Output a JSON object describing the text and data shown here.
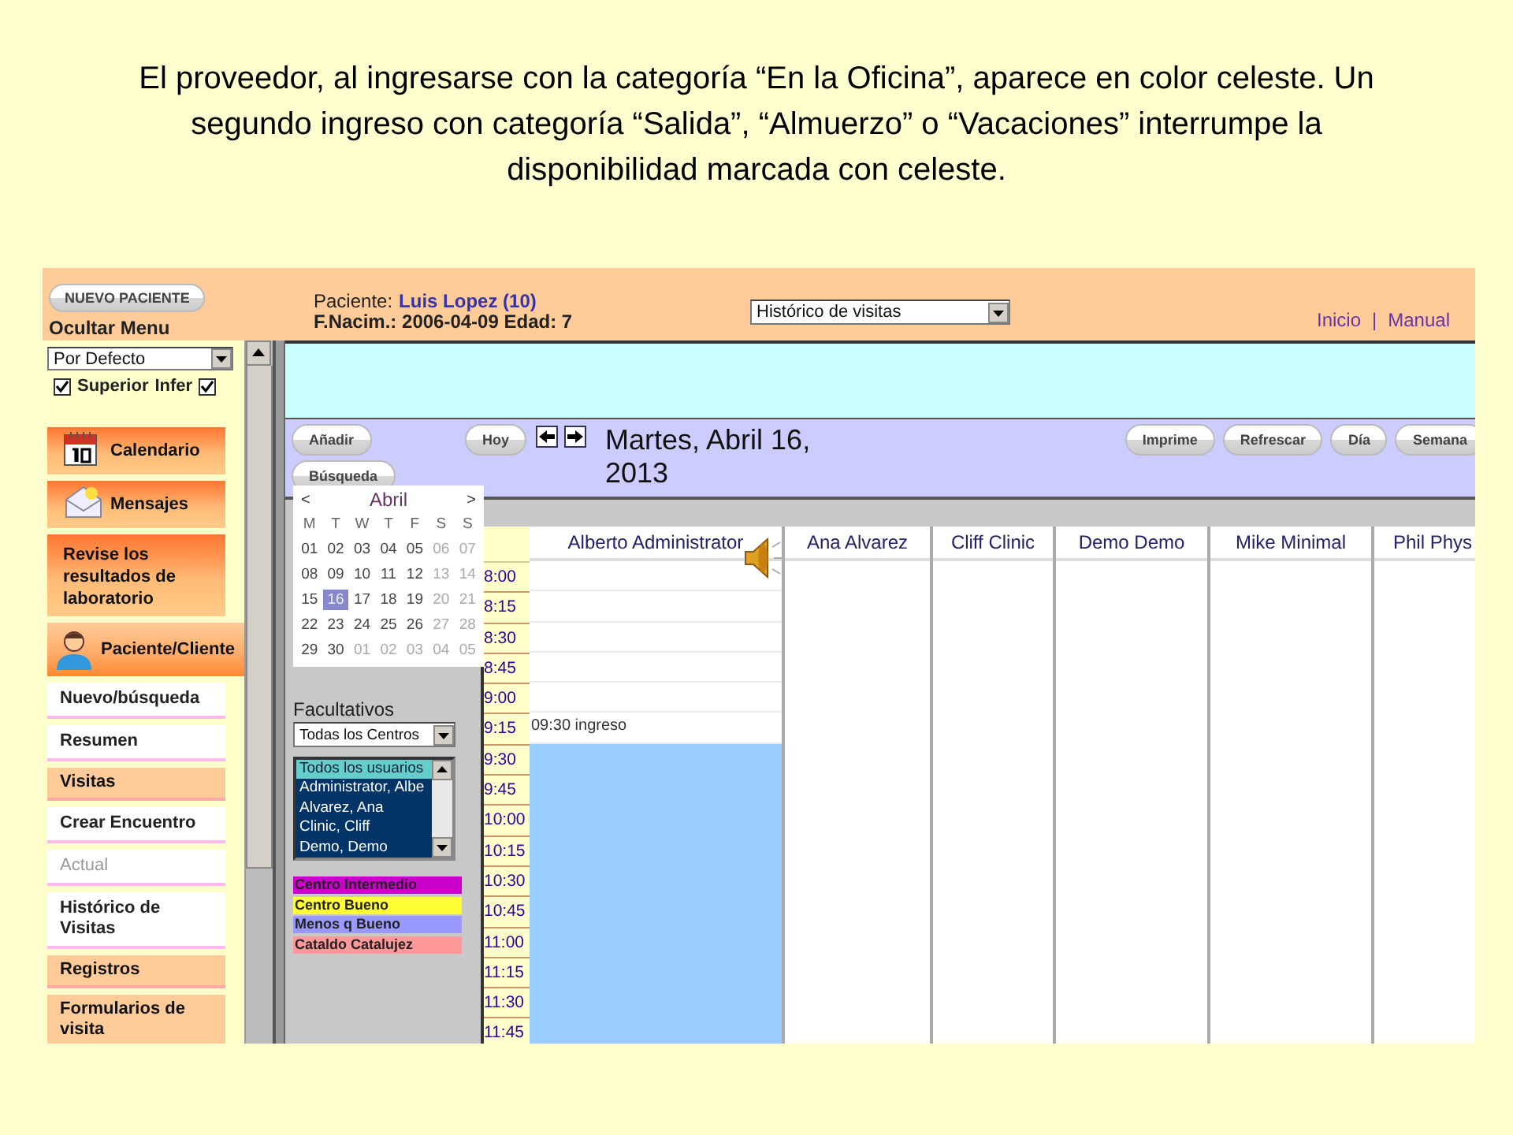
{
  "slide": {
    "caption": "El proveedor, al ingresarse con la categoría “En la Oficina”, aparece en color celeste. Un segundo ingreso con categoría “Salida”, “Almuerzo” o “Vacaciones” interrumpe la disponibilidad marcada con celeste."
  },
  "header": {
    "new_patient_button": "NUEVO PACIENTE",
    "hide_menu": "Ocultar Menu",
    "patient_label": "Paciente:",
    "patient_name": "Luis Lopez (10)",
    "birth_info": "F.Nacim.: 2006-04-09 Edad: 7",
    "view_select": "Histórico de visitas",
    "links": [
      "Inicio",
      "Manual"
    ],
    "separator": "|"
  },
  "sidebar": {
    "profile_select": "Por Defecto",
    "checkboxes": [
      {
        "label": "Superior",
        "checked": true
      },
      {
        "label": "Infer",
        "checked": true
      }
    ],
    "items": [
      {
        "kind": "calendar",
        "label": "Calendario",
        "disabled": false
      },
      {
        "kind": "messages",
        "label": "Mensajes",
        "disabled": false
      },
      {
        "kind": "plain",
        "label": "Revise los resultados de laboratorio",
        "disabled": false
      },
      {
        "kind": "patient",
        "label": "Paciente/Cliente",
        "disabled": false
      },
      {
        "kind": "link",
        "label": "Nuevo/búsqueda",
        "disabled": false
      },
      {
        "kind": "link",
        "label": "Resumen",
        "disabled": false
      },
      {
        "kind": "section",
        "label": "Visitas",
        "disabled": false
      },
      {
        "kind": "link",
        "label": "Crear Encuentro",
        "disabled": false
      },
      {
        "kind": "link",
        "label": "Actual",
        "disabled": true
      },
      {
        "kind": "link",
        "label": "Histórico de Visitas",
        "disabled": false
      },
      {
        "kind": "section",
        "label": "Registros",
        "disabled": false
      },
      {
        "kind": "section",
        "label": "Formularios de visita",
        "disabled": false
      }
    ]
  },
  "toolbar": {
    "left_buttons": [
      "Añadir",
      "Búsqueda",
      "Hoy"
    ],
    "date_title": "Martes, Abril 16, 2013",
    "right_buttons": [
      "Imprime",
      "Refrescar",
      "Día",
      "Semana"
    ]
  },
  "mini_calendar": {
    "prev": "<",
    "month": "Abril",
    "next": ">",
    "weekdays": [
      "M",
      "T",
      "W",
      "T",
      "F",
      "S",
      "S"
    ],
    "weeks": [
      [
        {
          "day": "01",
          "muted": false,
          "selected": false
        },
        {
          "day": "02",
          "muted": false,
          "selected": false
        },
        {
          "day": "03",
          "muted": false,
          "selected": false
        },
        {
          "day": "04",
          "muted": false,
          "selected": false
        },
        {
          "day": "05",
          "muted": false,
          "selected": false
        },
        {
          "day": "06",
          "muted": true,
          "selected": false
        },
        {
          "day": "07",
          "muted": true,
          "selected": false
        }
      ],
      [
        {
          "day": "08",
          "muted": false,
          "selected": false
        },
        {
          "day": "09",
          "muted": false,
          "selected": false
        },
        {
          "day": "10",
          "muted": false,
          "selected": false
        },
        {
          "day": "11",
          "muted": false,
          "selected": false
        },
        {
          "day": "12",
          "muted": false,
          "selected": false
        },
        {
          "day": "13",
          "muted": true,
          "selected": false
        },
        {
          "day": "14",
          "muted": true,
          "selected": false
        }
      ],
      [
        {
          "day": "15",
          "muted": false,
          "selected": false
        },
        {
          "day": "16",
          "muted": false,
          "selected": true
        },
        {
          "day": "17",
          "muted": false,
          "selected": false
        },
        {
          "day": "18",
          "muted": false,
          "selected": false
        },
        {
          "day": "19",
          "muted": false,
          "selected": false
        },
        {
          "day": "20",
          "muted": true,
          "selected": false
        },
        {
          "day": "21",
          "muted": true,
          "selected": false
        }
      ],
      [
        {
          "day": "22",
          "muted": false,
          "selected": false
        },
        {
          "day": "23",
          "muted": false,
          "selected": false
        },
        {
          "day": "24",
          "muted": false,
          "selected": false
        },
        {
          "day": "25",
          "muted": false,
          "selected": false
        },
        {
          "day": "26",
          "muted": false,
          "selected": false
        },
        {
          "day": "27",
          "muted": true,
          "selected": false
        },
        {
          "day": "28",
          "muted": true,
          "selected": false
        }
      ],
      [
        {
          "day": "29",
          "muted": false,
          "selected": false
        },
        {
          "day": "30",
          "muted": false,
          "selected": false
        },
        {
          "day": "01",
          "muted": true,
          "selected": false
        },
        {
          "day": "02",
          "muted": true,
          "selected": false
        },
        {
          "day": "03",
          "muted": true,
          "selected": false
        },
        {
          "day": "04",
          "muted": true,
          "selected": false
        },
        {
          "day": "05",
          "muted": true,
          "selected": false
        }
      ]
    ]
  },
  "providers": {
    "title": "Facultativos",
    "center_select": "Todas los Centros",
    "users": [
      {
        "label": "Todos los usuarios",
        "selected": true,
        "focused": true
      },
      {
        "label": "Administrator, Albe",
        "selected": true,
        "focused": false
      },
      {
        "label": "Alvarez, Ana",
        "selected": true,
        "focused": false
      },
      {
        "label": "Clinic, Cliff",
        "selected": true,
        "focused": false
      },
      {
        "label": "Demo, Demo",
        "selected": true,
        "focused": false
      }
    ]
  },
  "legend": [
    {
      "label": "Centro Intermedio",
      "color": "#cc00cc"
    },
    {
      "label": "Centro Bueno",
      "color": "#ffff33"
    },
    {
      "label": "Menos q Bueno",
      "color": "#9999ff"
    },
    {
      "label": "Cataldo Catalujez",
      "color": "#ff9999"
    }
  ],
  "schedule": {
    "times": [
      "8:00",
      "8:15",
      "8:30",
      "8:45",
      "9:00",
      "9:15",
      "9:30",
      "9:45",
      "10:00",
      "10:15",
      "10:30",
      "10:45",
      "11:00",
      "11:15",
      "11:30",
      "11:45"
    ],
    "columns": [
      {
        "name": "Alberto Administrator",
        "slots": [
          {
            "available": false
          },
          {
            "available": false
          },
          {
            "available": false
          },
          {
            "available": false
          },
          {
            "available": false
          },
          {
            "available": false,
            "note": "09:30 ingreso"
          },
          {
            "available": true
          },
          {
            "available": true
          },
          {
            "available": true
          },
          {
            "available": true
          },
          {
            "available": true
          },
          {
            "available": true
          },
          {
            "available": true
          },
          {
            "available": true
          },
          {
            "available": true
          },
          {
            "available": true
          }
        ]
      },
      {
        "name": "Ana Alvarez"
      },
      {
        "name": "Cliff Clinic"
      },
      {
        "name": "Demo Demo"
      },
      {
        "name": "Mike Minimal"
      },
      {
        "name": "Phil Phys"
      }
    ]
  }
}
